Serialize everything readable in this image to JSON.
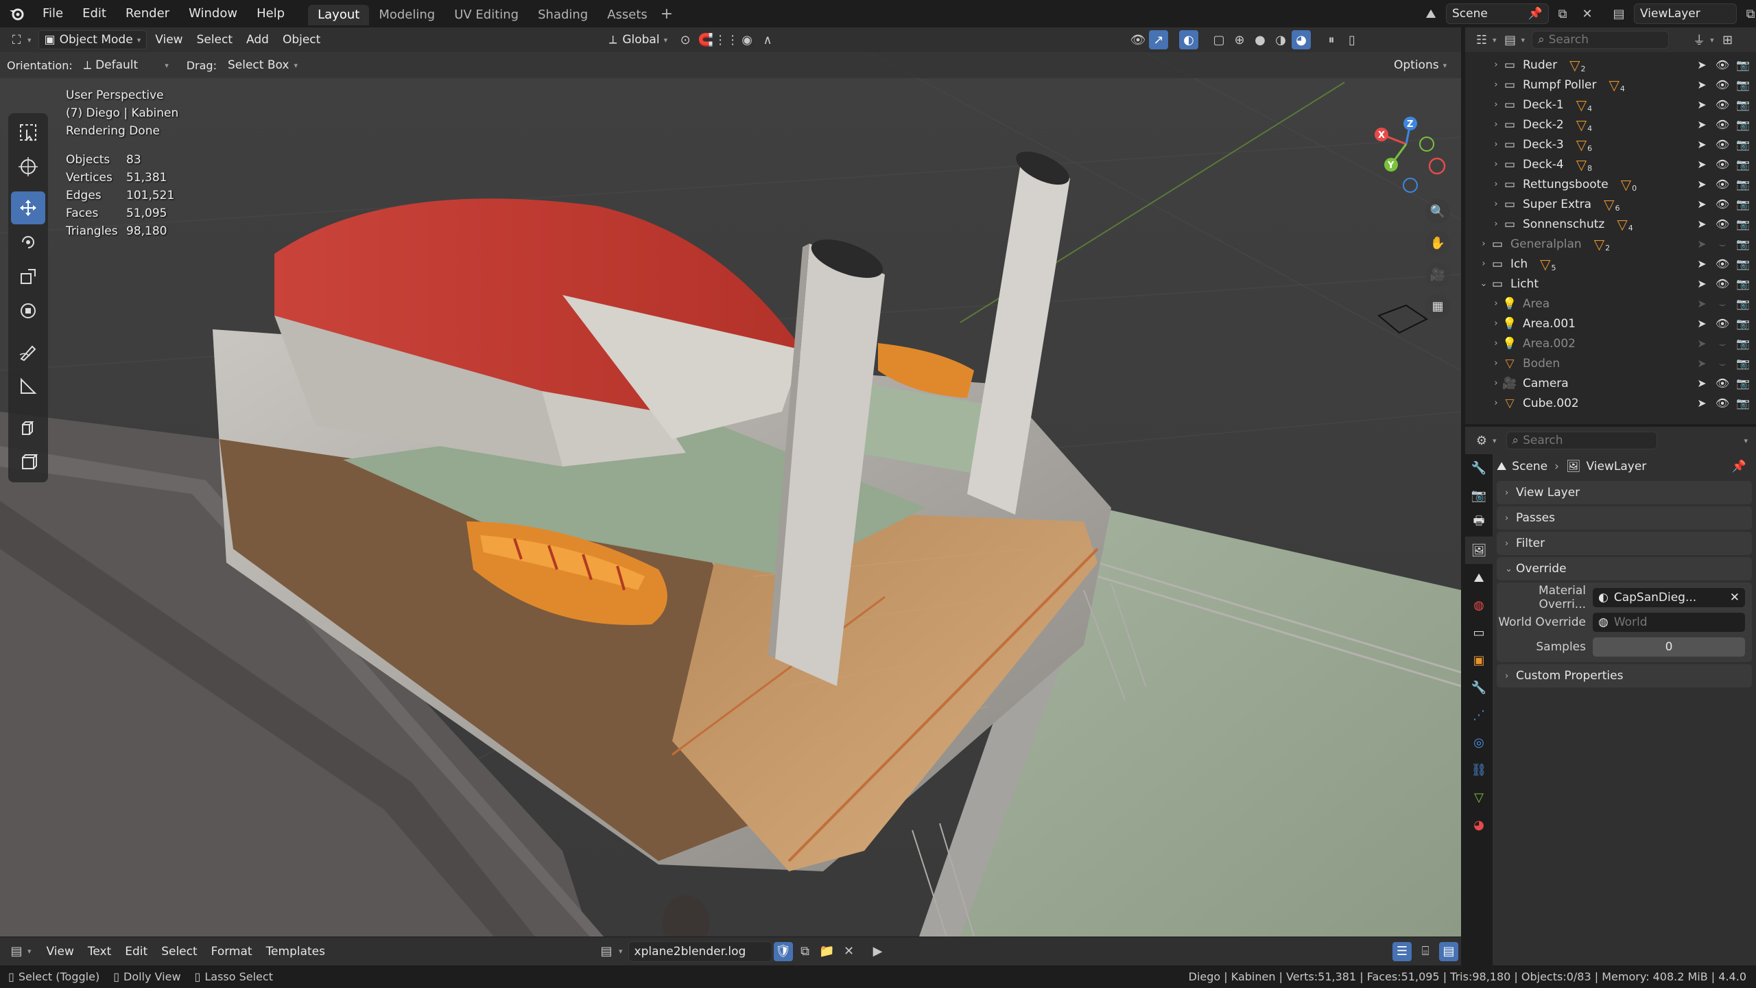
{
  "menubar": {
    "items": [
      "File",
      "Edit",
      "Render",
      "Window",
      "Help"
    ],
    "workspaces": [
      "Layout",
      "Modeling",
      "UV Editing",
      "Shading",
      "Assets"
    ],
    "active_workspace": "Layout",
    "scene": "Scene",
    "view_layer": "ViewLayer"
  },
  "viewport_header": {
    "mode": "Object Mode",
    "menus": [
      "View",
      "Select",
      "Add",
      "Object"
    ],
    "transform_orientation": "Global",
    "orientation_label": "Orientation:",
    "orientation_value": "Default",
    "drag_label": "Drag:",
    "drag_value": "Select Box",
    "options": "Options"
  },
  "overlay": {
    "view_name": "User Perspective",
    "collection": "(7) Diego | Kabinen",
    "render_status": "Rendering Done",
    "stats": [
      {
        "key": "Objects",
        "value": "83"
      },
      {
        "key": "Vertices",
        "value": "51,381"
      },
      {
        "key": "Edges",
        "value": "101,521"
      },
      {
        "key": "Faces",
        "value": "51,095"
      },
      {
        "key": "Triangles",
        "value": "98,180"
      }
    ]
  },
  "gizmo": {
    "x": "X",
    "y": "Y",
    "z": "Z"
  },
  "outliner": {
    "search_placeholder": "Search",
    "rows": [
      {
        "label": "Ruder",
        "indent": 1,
        "count": "2",
        "dim": false
      },
      {
        "label": "Rumpf Poller",
        "indent": 1,
        "count": "4",
        "dim": false
      },
      {
        "label": "Deck-1",
        "indent": 1,
        "count": "4",
        "dim": false
      },
      {
        "label": "Deck-2",
        "indent": 1,
        "count": "4",
        "dim": false
      },
      {
        "label": "Deck-3",
        "indent": 1,
        "count": "6",
        "dim": false
      },
      {
        "label": "Deck-4",
        "indent": 1,
        "count": "8",
        "dim": false
      },
      {
        "label": "Rettungsboote",
        "indent": 1,
        "count": "0",
        "dim": false
      },
      {
        "label": "Super Extra",
        "indent": 1,
        "count": "6",
        "dim": false
      },
      {
        "label": "Sonnenschutz",
        "indent": 1,
        "count": "4",
        "dim": false
      },
      {
        "label": "Generalplan",
        "indent": 0,
        "count": "2",
        "dim": true
      },
      {
        "label": "Ich",
        "indent": 0,
        "count": "5",
        "dim": false
      },
      {
        "label": "Licht",
        "indent": 0,
        "count": "",
        "dim": false
      },
      {
        "label": "Area",
        "indent": 1,
        "count": "",
        "dim": true
      },
      {
        "label": "Area.001",
        "indent": 1,
        "count": "",
        "dim": false
      },
      {
        "label": "Area.002",
        "indent": 1,
        "count": "",
        "dim": true
      },
      {
        "label": "Boden",
        "indent": 1,
        "count": "",
        "dim": true
      },
      {
        "label": "Camera",
        "indent": 1,
        "count": "",
        "dim": false
      },
      {
        "label": "Cube.002",
        "indent": 1,
        "count": "",
        "dim": false
      }
    ]
  },
  "properties": {
    "search_placeholder": "Search",
    "breadcrumb_scene": "Scene",
    "breadcrumb_layer": "ViewLayer",
    "panels": [
      "View Layer",
      "Passes",
      "Filter",
      "Override",
      "Custom Properties"
    ],
    "material_override_label": "Material Overri...",
    "material_override_value": "CapSanDieg...",
    "world_override_label": "World Override",
    "world_override_placeholder": "World",
    "samples_label": "Samples",
    "samples_value": "0"
  },
  "text_editor": {
    "menus": [
      "View",
      "Text",
      "Edit",
      "Select",
      "Format",
      "Templates"
    ],
    "filename": "xplane2blender.log"
  },
  "statusbar": {
    "hints": [
      "Select (Toggle)",
      "Dolly View",
      "Lasso Select"
    ],
    "info": "Diego | Kabinen | Verts:51,381 | Faces:51,095 | Tris:98,180 | Objects:0/83 | Memory: 408.2 MiB | 4.4.0"
  },
  "colors": {
    "accent": "#4772b3",
    "orange": "#e6932e",
    "x_axis": "#e64a4a",
    "y_axis": "#7ac23c",
    "z_axis": "#3d87e0"
  }
}
